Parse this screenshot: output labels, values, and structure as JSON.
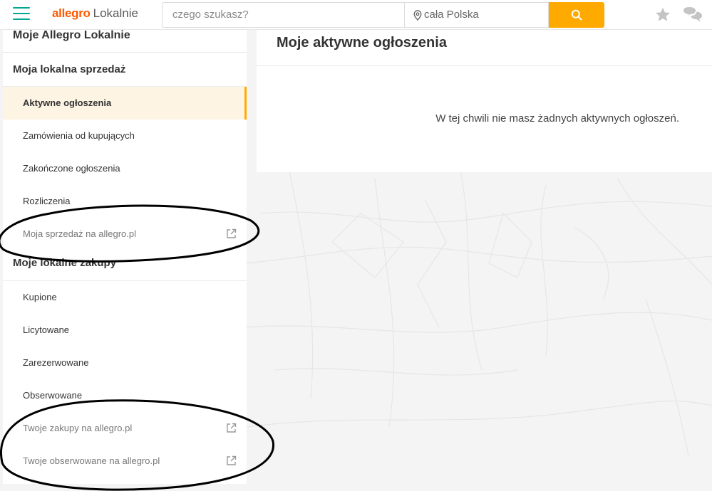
{
  "header": {
    "logo_brand": "allegro",
    "logo_sub": "Lokalnie",
    "search_placeholder": "czego szukasz?",
    "location": "cała Polska",
    "accent": "#ffaa00",
    "brand_color": "#ff5a00",
    "menu_color": "#00a790",
    "icons": [
      "menu-icon",
      "location-pin-icon",
      "search-icon",
      "star-icon",
      "chat-icon"
    ]
  },
  "sidebar": {
    "title": "Moje Allegro Lokalnie",
    "sales": {
      "title": "Moja lokalna sprzedaż",
      "items": [
        {
          "label": "Aktywne ogłoszenia",
          "active": true
        },
        {
          "label": "Zamówienia od kupujących"
        },
        {
          "label": "Zakończone ogłoszenia"
        },
        {
          "label": "Rozliczenia"
        },
        {
          "label": "Moja sprzedaż na allegro.pl",
          "external": true
        }
      ]
    },
    "purchases": {
      "title": "Moje lokalne zakupy",
      "items": [
        {
          "label": "Kupione"
        },
        {
          "label": "Licytowane"
        },
        {
          "label": "Zarezerwowane"
        },
        {
          "label": "Obserwowane"
        },
        {
          "label": "Twoje zakupy na allegro.pl",
          "external": true
        },
        {
          "label": "Twoje obserwowane na allegro.pl",
          "external": true
        }
      ]
    }
  },
  "main": {
    "title": "Moje aktywne ogłoszenia",
    "empty_message": "W tej chwili nie masz żadnych aktywnych ogłoszeń."
  }
}
